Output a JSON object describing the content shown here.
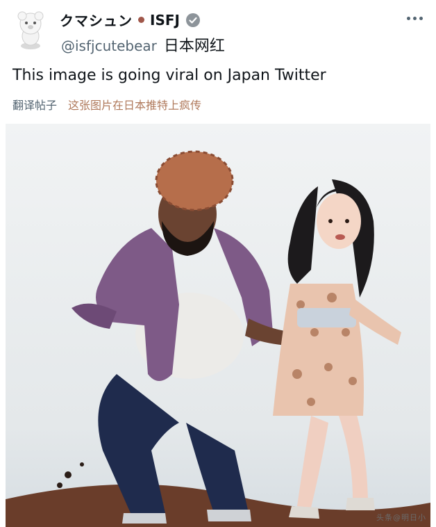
{
  "post": {
    "display_name": "クマシュン",
    "mbti": "ISFJ",
    "handle": "@isfjcutebear",
    "tag": "日本网红",
    "text": "This image is going viral on Japan Twitter",
    "translate_label": "翻译帖子",
    "translated_text": "这张图片在日本推特上疯传"
  },
  "media": {
    "watermark": "头条@明日小"
  },
  "icons": {
    "avatar": "bear-avatar",
    "verified": "verified-badge-icon",
    "more": "more-icon"
  },
  "colors": {
    "dot": "#a0574a",
    "handle": "#536471",
    "translated_text": "#b07a5c"
  }
}
